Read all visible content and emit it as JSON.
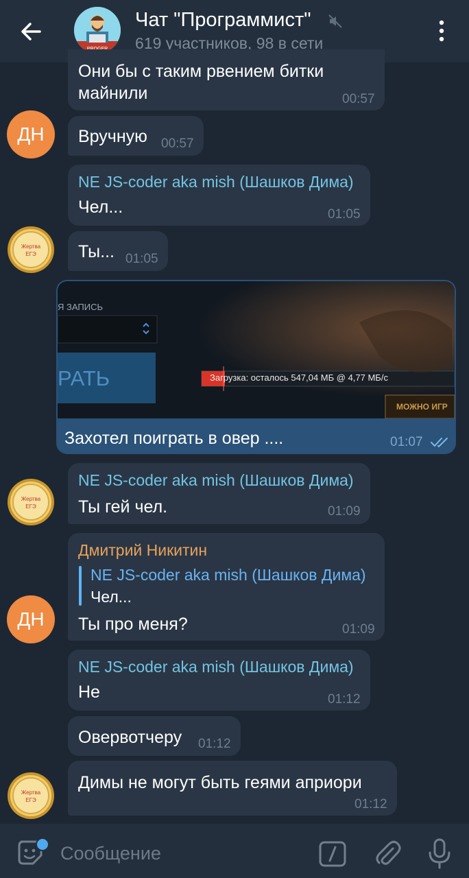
{
  "header": {
    "title": "Чат \"Программист\"",
    "subtitle": "619 участников, 98 в сети"
  },
  "messages": [
    {
      "text_lines": [
        "Они бы с таким рвением битки",
        "майнили"
      ],
      "time": "00:57"
    },
    {
      "avatar": "ДН",
      "text": "Вручную",
      "time": "00:57"
    },
    {
      "sender": "NE JS-coder aka mish (Шашков Дима)",
      "text": "Чел...",
      "time": "01:05"
    },
    {
      "avatar_medal": "Жертва ЕГЭ",
      "text": "Ты...",
      "time": "01:05"
    },
    {
      "outgoing": true,
      "photo": {
        "label_top": "Я ЗАПИСЬ",
        "big_button": "РАТЬ",
        "download_text": "Загрузка: осталось 547,04 МБ @ 4,77 МБ/с",
        "play_button": "МОЖНО ИГР"
      },
      "text": "Захотел поиграть в овер ....",
      "time": "01:07"
    },
    {
      "sender": "NE JS-coder aka mish (Шашков Дима)",
      "text": "Ты гей чел.",
      "time": "01:09"
    },
    {
      "sender": "Дмитрий Никитин",
      "reply": {
        "name": "NE JS-coder aka mish (Шашков Дима)",
        "text": "Чел..."
      },
      "text": "Ты про меня?",
      "time": "01:09"
    },
    {
      "sender": "NE JS-coder aka mish (Шашков Дима)",
      "text": "Не",
      "time": "01:12"
    },
    {
      "text": "Овервотчеру",
      "time": "01:12"
    },
    {
      "text": "Димы не могут быть геями априори",
      "time": "01:12"
    }
  ],
  "input": {
    "placeholder": "Сообщение"
  },
  "colors": {
    "background": "#1d2733",
    "header": "#242f3d",
    "incoming_bubble": "#2a3645",
    "outgoing_bubble": "#2b5278",
    "sender_blue": "#73c4e3",
    "sender_orange": "#e8a25c",
    "avatar_orange": "#ef8b43"
  },
  "icons": [
    "back-arrow-icon",
    "mute-icon",
    "more-vertical-icon",
    "sticker-icon",
    "bot-command-icon",
    "attach-icon",
    "microphone-icon",
    "double-check-icon"
  ]
}
